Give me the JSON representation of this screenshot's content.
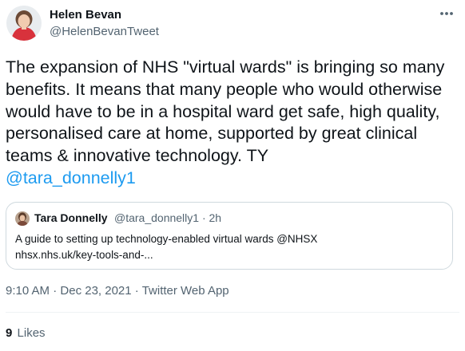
{
  "author": {
    "name": "Helen Bevan",
    "handle": "@HelenBevanTweet"
  },
  "tweet": {
    "text": "The expansion of NHS \"virtual wards\" is bringing so many benefits. It means that many people who would otherwise would have to be in a hospital ward get safe, high quality, personalised care at home, supported by great clinical teams & innovative technology. TY",
    "mention": "@tara_donnelly1"
  },
  "quote": {
    "name": "Tara Donnelly",
    "handle": "@tara_donnelly1",
    "separator": "·",
    "time": "2h",
    "line1": "A guide to setting up technology-enabled virtual wards @NHSX",
    "line2": "nhsx.nhs.uk/key-tools-and-..."
  },
  "meta": {
    "time": "9:10 AM",
    "separator": "·",
    "date": "Dec 23, 2021",
    "source": "Twitter Web App"
  },
  "stats": {
    "likes_count": "9",
    "likes_label": "Likes"
  },
  "icons": {
    "more": "more-horizontal-icon"
  },
  "colors": {
    "accent": "#1d9bf0",
    "secondary_text": "#536471",
    "primary_text": "#0f1419",
    "border": "#cfd9de"
  }
}
